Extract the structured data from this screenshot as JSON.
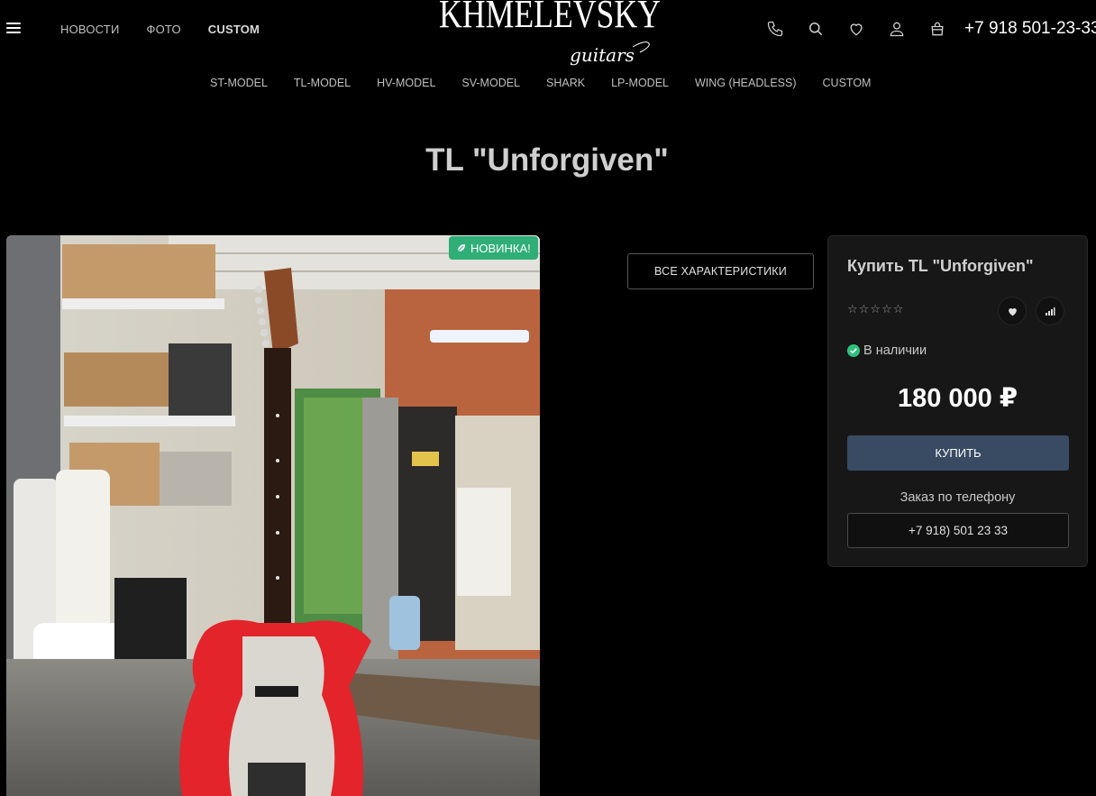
{
  "header": {
    "menu_icon": "hamburger-icon",
    "nav": [
      {
        "label": "НОВОСТИ"
      },
      {
        "label": "ФОТО"
      },
      {
        "label": "CUSTOM"
      }
    ],
    "logo": {
      "main": "KHMELEVSKY",
      "sub": "guitars"
    },
    "icons": [
      "phone-icon",
      "search-icon",
      "heart-icon",
      "user-icon",
      "cart-icon"
    ],
    "phone": "+7 918 501-23-33"
  },
  "catnav": [
    {
      "label": "ST-MODEL"
    },
    {
      "label": "TL-MODEL"
    },
    {
      "label": "HV-MODEL"
    },
    {
      "label": "SV-MODEL"
    },
    {
      "label": "SHARK"
    },
    {
      "label": "LP-MODEL"
    },
    {
      "label": "WING (HEADLESS)"
    },
    {
      "label": "CUSTOM"
    }
  ],
  "product": {
    "title": "TL \"Unforgiven\"",
    "badge": "НОВИНКА!",
    "specs_button": "ВСЕ ХАРАКТЕРИСТИКИ",
    "rating": 0,
    "buy_title": "Купить TL \"Unforgiven\"",
    "stock": "В наличии",
    "price": "180 000 ₽",
    "buy_button": "КУПИТЬ",
    "phone_order_label": "Заказ по телефону",
    "phone_order": "+7 918) 501 23 33"
  },
  "colors": {
    "background": "#000000",
    "panel": "#171717",
    "buy_button": "#394a63",
    "badge": "#2fae78",
    "stock_check": "#2fc27e"
  }
}
